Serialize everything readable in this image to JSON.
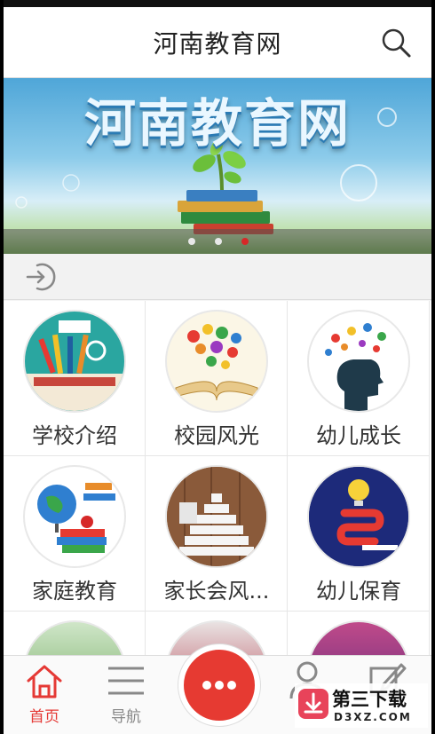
{
  "header": {
    "title": "河南教育网"
  },
  "banner": {
    "text": "河南教育网",
    "dots": 3,
    "active_dot": 2
  },
  "grid": {
    "items": [
      {
        "label": "学校介绍",
        "icon": "back-to-school-icon"
      },
      {
        "label": "校园风光",
        "icon": "open-book-icon"
      },
      {
        "label": "幼儿成长",
        "icon": "head-ideas-icon"
      },
      {
        "label": "家庭教育",
        "icon": "globe-books-icon"
      },
      {
        "label": "家长会风...",
        "icon": "abc-blocks-icon"
      },
      {
        "label": "幼儿保育",
        "icon": "lightbulb-icon"
      },
      {
        "label": "",
        "icon": "partial-image-icon"
      },
      {
        "label": "",
        "icon": "partial-image-icon"
      },
      {
        "label": "",
        "icon": "partial-image-icon"
      }
    ]
  },
  "nav": {
    "items": [
      {
        "label": "首页",
        "icon": "home-icon",
        "active": true
      },
      {
        "label": "导航",
        "icon": "menu-icon",
        "active": false
      },
      {
        "label": "",
        "icon": "user-icon",
        "active": false
      },
      {
        "label": "",
        "icon": "edit-icon",
        "active": false
      }
    ],
    "fab_icon": "more-dots-icon"
  },
  "watermark": {
    "title": "第三下载",
    "sub": "D3XZ.COM"
  },
  "colors": {
    "accent": "#e53935",
    "fab": "#e63a32"
  }
}
